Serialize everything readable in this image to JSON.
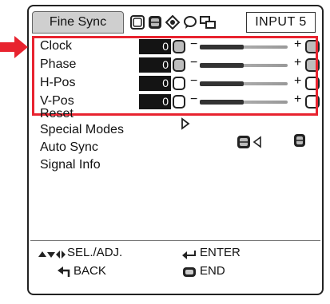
{
  "tabs": {
    "active_label": "Fine Sync",
    "icons": [
      "picture-tab-icon",
      "fine-sync-tab-icon",
      "setup-tab-icon",
      "options-tab-icon",
      "network-tab-icon"
    ],
    "input_label": "INPUT 5"
  },
  "adjustments": [
    {
      "label": "Clock",
      "value": "0",
      "level": 0.5
    },
    {
      "label": "Phase",
      "value": "0",
      "level": 0.5
    },
    {
      "label": "H-Pos",
      "value": "0",
      "level": 0.5
    },
    {
      "label": "V-Pos",
      "value": "0",
      "level": 0.5
    }
  ],
  "slider_signs": {
    "minus": "−",
    "plus": "+"
  },
  "menu": {
    "reset": "Reset",
    "special_modes": "Special Modes",
    "auto_sync": "Auto Sync",
    "signal_info": "Signal Info"
  },
  "footer": {
    "sel_adj": "SEL./ADJ.",
    "enter": "ENTER",
    "back": "BACK",
    "end": "END"
  },
  "colors": {
    "highlight": "#e8232f",
    "arrow": "#e8232f"
  }
}
